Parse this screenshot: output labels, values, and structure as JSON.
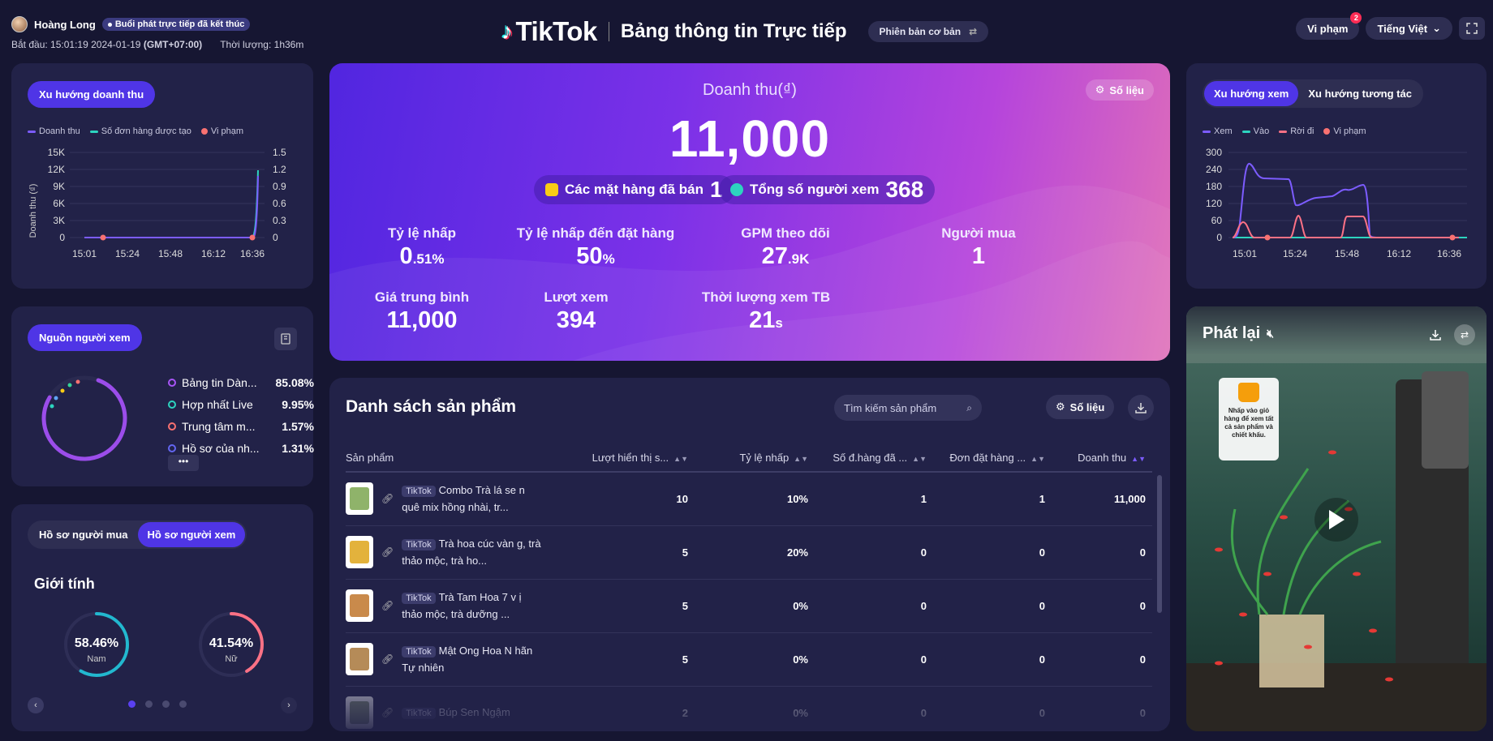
{
  "header": {
    "user_name": "Hoàng Long",
    "live_status": "Buổi phát trực tiếp đã kết thúc",
    "start_label": "Bắt đầu:",
    "start_time": "15:01:19 2024-01-19",
    "timezone": "(GMT+07:00)",
    "duration_label": "Thời lượng:",
    "duration": "1h36m",
    "brand": "TikTok",
    "title": "Bảng thông tin Trực tiếp",
    "version_label": "Phiên bản cơ bản",
    "violations_label": "Vi phạm",
    "violations_count": "2",
    "language": "Tiếng Việt"
  },
  "revenue_trend": {
    "tab": "Xu hướng doanh thu",
    "legend": [
      "Doanh thu",
      "Số đơn hàng được tạo",
      "Vi phạm"
    ],
    "y_left_label": "Doanh thu (₫)",
    "y_left_ticks": [
      "15K",
      "12K",
      "9K",
      "6K",
      "3K",
      "0"
    ],
    "y_right_ticks": [
      "1.5",
      "1.2",
      "0.9",
      "0.6",
      "0.3",
      "0"
    ],
    "x_ticks": [
      "15:01",
      "15:24",
      "15:48",
      "16:12",
      "16:36"
    ]
  },
  "viewer_source": {
    "tab": "Nguồn người xem",
    "items": [
      {
        "label": "Bảng tin Dàn...",
        "value": "85.08%",
        "color": "#a855f7"
      },
      {
        "label": "Hợp nhất Live",
        "value": "9.95%",
        "color": "#2dd4bf"
      },
      {
        "label": "Trung tâm m...",
        "value": "1.57%",
        "color": "#f87171"
      },
      {
        "label": "Hồ sơ của nh...",
        "value": "1.31%",
        "color": "#6366f1"
      }
    ],
    "more": "•••"
  },
  "profile": {
    "tab_buyer": "Hồ sơ người mua",
    "tab_viewer": "Hồ sơ người xem",
    "section": "Giới tính",
    "male_pct": "58.46%",
    "male_label": "Nam",
    "male_fraction": 0.5846,
    "female_pct": "41.54%",
    "female_label": "Nữ",
    "female_fraction": 0.4154
  },
  "hero": {
    "title": "Doanh thu(₫)",
    "revenue": "11,000",
    "solieu": "Số liệu",
    "sold_label": "Các mặt hàng đã bán",
    "sold_value": "1",
    "viewers_label": "Tổng số người xem",
    "viewers_value": "368",
    "metrics": [
      {
        "label": "Tỷ lệ nhấp",
        "value": "0",
        "unit": ".51%"
      },
      {
        "label": "Tỷ lệ nhấp đến đặt hàng",
        "value": "50",
        "unit": "%"
      },
      {
        "label": "GPM theo dõi",
        "value": "27",
        "unit": ".9K"
      },
      {
        "label": "Người mua",
        "value": "1",
        "unit": ""
      },
      {
        "label": "Giá trung bình",
        "value": "11,000",
        "unit": ""
      },
      {
        "label": "Lượt xem",
        "value": "394",
        "unit": ""
      },
      {
        "label": "Thời lượng xem TB",
        "value": "21",
        "unit": "s"
      }
    ]
  },
  "products": {
    "title": "Danh sách sản phẩm",
    "search_placeholder": "Tìm kiếm sản phẩm",
    "solieu": "Số liệu",
    "columns": [
      "Sản phẩm",
      "Lượt hiển thị s...",
      "Tỷ lệ nhấp",
      "Số đ.hàng đã ...",
      "Đơn đặt hàng ...",
      "Doanh thu"
    ],
    "tag": "TikTok",
    "rows": [
      {
        "name": "Combo Trà lá se n quê mix hồng nhài, tr...",
        "impressions": "10",
        "ctr": "10%",
        "sold": "1",
        "orders": "1",
        "revenue": "11,000",
        "color": "#8fb36a"
      },
      {
        "name": "Trà hoa cúc vàn g, trà thảo mộc, trà ho...",
        "impressions": "5",
        "ctr": "20%",
        "sold": "0",
        "orders": "0",
        "revenue": "0",
        "color": "#e3b23c"
      },
      {
        "name": "Trà Tam Hoa 7 v ị thảo mộc, trà dưỡng ...",
        "impressions": "5",
        "ctr": "0%",
        "sold": "0",
        "orders": "0",
        "revenue": "0",
        "color": "#c98a4b"
      },
      {
        "name": "Mật Ong Hoa N hãn Tự nhiên",
        "impressions": "5",
        "ctr": "0%",
        "sold": "0",
        "orders": "0",
        "revenue": "0",
        "color": "#b58b58"
      },
      {
        "name": "Búp Sen Ngậm",
        "impressions": "2",
        "ctr": "0%",
        "sold": "0",
        "orders": "0",
        "revenue": "0",
        "color": "#8a9a7a"
      }
    ]
  },
  "engagement": {
    "tab_views": "Xu hướng xem",
    "tab_interact": "Xu hướng tương tác",
    "legend": [
      "Xem",
      "Vào",
      "Rời đi",
      "Vi phạm"
    ],
    "y_ticks": [
      "300",
      "240",
      "180",
      "120",
      "60",
      "0"
    ],
    "x_ticks": [
      "15:01",
      "15:24",
      "15:48",
      "16:12",
      "16:36"
    ]
  },
  "replay": {
    "title": "Phát lại",
    "cart_tip": "Nhấp vào giỏ hàng để xem tất cả sản phẩm và chiết khấu."
  },
  "colors": {
    "accent": "#4f35e6",
    "revenue": "#7c5cff",
    "orders": "#2dd4bf",
    "violation": "#f87171",
    "views": "#7c5cff",
    "leave": "#fb7185"
  }
}
